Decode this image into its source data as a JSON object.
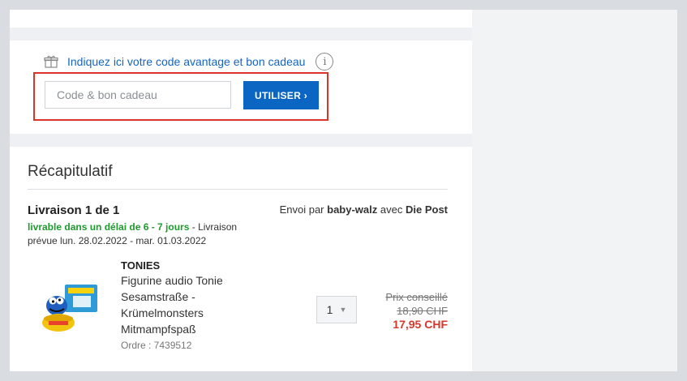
{
  "coupon": {
    "link_label": "Indiquez ici votre code avantage et bon cadeau",
    "info_symbol": "i",
    "input_placeholder": "Code & bon cadeau",
    "input_value": "",
    "button_label": "UTILISER ›"
  },
  "summary": {
    "title": "Récapitulatif",
    "delivery_title": "Livraison 1 de 1",
    "ship_prefix": "Envoi par",
    "ship_seller": "baby-walz",
    "ship_with": "avec",
    "ship_carrier": "Die Post",
    "availability_green": "livrable dans un délai de 6 - 7 jours",
    "availability_rest": " - Livraison prévue lun. 28.02.2022 - mar. 01.03.2022"
  },
  "product": {
    "brand": "TONIES",
    "name_lines": [
      "Figurine audio Tonie",
      "Sesamstraße -",
      "Krümelmonsters",
      "Mitmampfspaß"
    ],
    "order_number": "Ordre : 7439512",
    "quantity": "1",
    "price_label": "Prix conseillé",
    "price_old": "18,90 CHF",
    "price_new": "17,95 CHF"
  },
  "colors": {
    "accent": "#0b66c3",
    "highlight_border": "#d9352a",
    "availability": "#1e9a2e",
    "sale_price": "#d9352a"
  },
  "icons": {
    "gift": "gift-icon",
    "info": "info-icon",
    "dropdown": "chevron-down-icon"
  }
}
